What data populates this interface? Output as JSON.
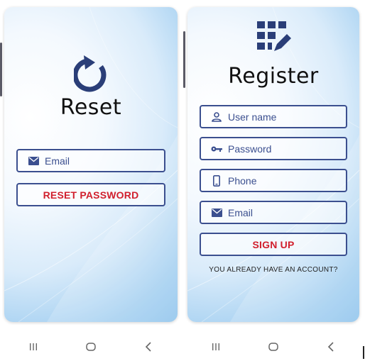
{
  "reset_screen": {
    "title": "Reset",
    "email_placeholder": "Email",
    "reset_button": "RESET PASSWORD"
  },
  "register_screen": {
    "title": "Register",
    "username_placeholder": "User name",
    "password_placeholder": "Password",
    "phone_placeholder": "Phone",
    "email_placeholder": "Email",
    "signup_button": "SIGN UP",
    "account_hint": "YOU ALREADY HAVE AN ACCOUNT?"
  },
  "colors": {
    "field_border": "#3b4f8f",
    "button_text": "#d11f2c",
    "icon": "#3b4f8f"
  },
  "icons": {
    "reset": "refresh-icon",
    "register": "grid-edit-icon",
    "email": "email-icon",
    "user": "user-icon",
    "password": "key-icon",
    "phone": "phone-icon"
  }
}
